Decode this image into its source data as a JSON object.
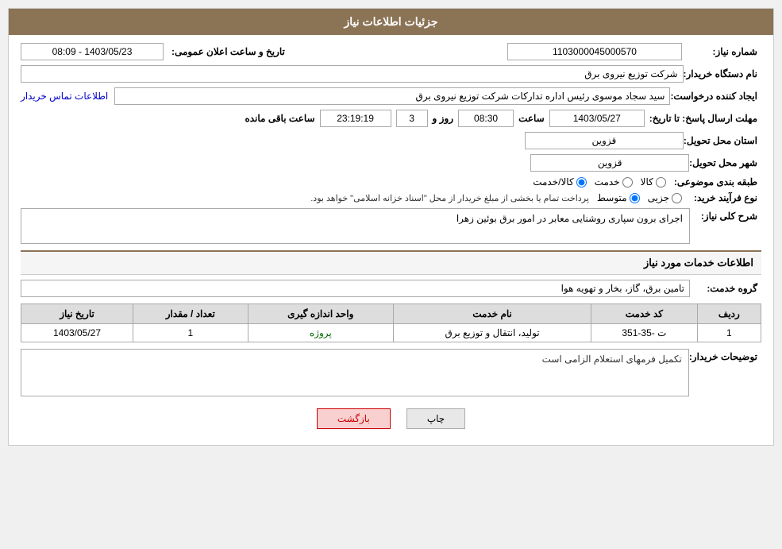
{
  "header": {
    "title": "جزئیات اطلاعات نیاز"
  },
  "fields": {
    "shmaare_label": "شماره نیاز:",
    "shmaare_value": "1103000045000570",
    "naam_dastgaah_label": "نام دستگاه خریدار:",
    "naam_dastgaah_value": "شرکت توزیع نیروی برق",
    "ijad_label": "ایجاد کننده درخواست:",
    "ijad_value": "سید سجاد موسوی رئیس اداره تدارکات شرکت توزیع نیروی برق",
    "ijad_link": "اطلاعات تماس خریدار",
    "mohlat_label": "مهلت ارسال پاسخ: تا تاریخ:",
    "mohlat_date": "1403/05/27",
    "mohlat_saat_label": "ساعت",
    "mohlat_saat": "08:30",
    "mohlat_rooz_label": "روز و",
    "mohlat_rooz": "3",
    "mohlat_baaghi_label": "ساعت باقی مانده",
    "mohlat_baaghi": "23:19:19",
    "ostaan_label": "استان محل تحویل:",
    "ostaan_value": "قزوین",
    "shahr_label": "شهر محل تحویل:",
    "shahr_value": "قزوین",
    "tarikho_saat_label": "تاریخ و ساعت اعلان عمومی:",
    "tarikho_saat_value": "1403/05/23 - 08:09",
    "tabaghe_label": "طبقه بندی موضوعی:",
    "tabaghe_options": [
      {
        "label": "کالا",
        "selected": false
      },
      {
        "label": "خدمت",
        "selected": false
      },
      {
        "label": "کالا/خدمت",
        "selected": true
      }
    ],
    "nooe_label": "نوع فرآیند خرید:",
    "nooe_options": [
      {
        "label": "جزیی",
        "selected": false
      },
      {
        "label": "متوسط",
        "selected": true
      }
    ],
    "nooe_note": "پرداخت تمام یا بخشی از مبلغ خریدار از محل \"اسناد خزانه اسلامی\" خواهد بود.",
    "sharh_label": "شرح کلی نیاز:",
    "sharh_value": "اجرای برون سپاری روشنایی معابر در امور برق بوئین زهرا",
    "khadamat_header": "اطلاعات خدمات مورد نیاز",
    "goroh_label": "گروه خدمت:",
    "goroh_value": "تامین برق، گاز، بخار و تهویه هوا",
    "table": {
      "headers": [
        "ردیف",
        "کد خدمت",
        "نام خدمت",
        "واحد اندازه گیری",
        "تعداد / مقدار",
        "تاریخ نیاز"
      ],
      "rows": [
        {
          "radif": "1",
          "code": "ت -35-351",
          "name": "تولید، انتقال و توزیع برق",
          "unit": "پروژه",
          "tedad": "1",
          "tarikh": "1403/05/27"
        }
      ]
    },
    "tosif_label": "توضیحات خریدار:",
    "tosif_value": "تکمیل فرمهای استعلام الزامی است"
  },
  "buttons": {
    "print": "چاپ",
    "back": "بازگشت"
  }
}
